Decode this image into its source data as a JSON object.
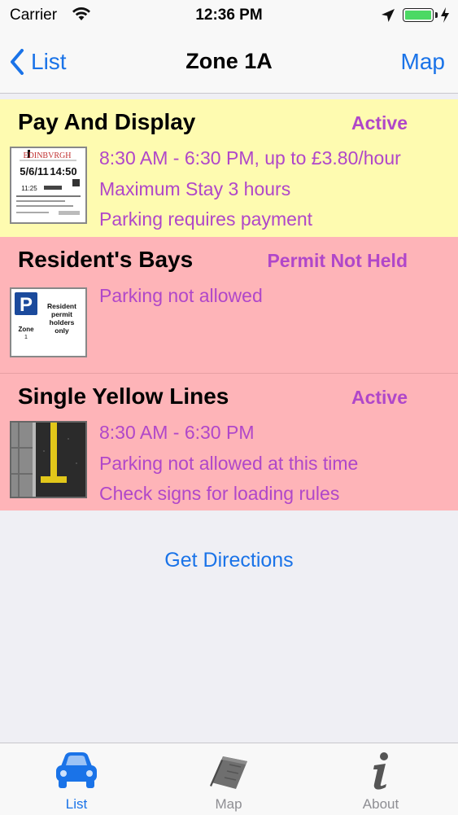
{
  "status_bar": {
    "carrier": "Carrier",
    "time": "12:36 PM"
  },
  "nav": {
    "back_label": "List",
    "title": "Zone 1A",
    "right_label": "Map"
  },
  "restrictions": [
    {
      "title": "Pay And Display",
      "status": "Active",
      "icon": "pay-and-display-ticket",
      "lines": [
        "8:30 AM - 6:30 PM, up to £3.80/hour",
        "Maximum Stay 3 hours",
        "Parking requires payment"
      ],
      "background": "#fefbb0"
    },
    {
      "title": "Resident's Bays",
      "status": "Permit Not Held",
      "icon": "resident-permit-sign",
      "lines": [
        "Parking not allowed"
      ],
      "background": "#feb4b8"
    },
    {
      "title": "Single Yellow Lines",
      "status": "Active",
      "icon": "single-yellow-line-road",
      "lines": [
        "8:30 AM - 6:30 PM",
        "Parking not allowed at this time",
        "Check signs for loading rules"
      ],
      "background": "#feb4b8"
    }
  ],
  "thumb_text": {
    "ticket_brand": "EDINBVRGH",
    "ticket_code": "5/6/11",
    "ticket_time": "14:50",
    "ticket_small": "11:25",
    "resident_sign": "Resident permit holders only",
    "resident_zone": "Zone 1",
    "resident_p": "P"
  },
  "directions_label": "Get Directions",
  "tabs": [
    {
      "label": "List",
      "icon": "car-icon",
      "selected": true
    },
    {
      "label": "Map",
      "icon": "map-icon",
      "selected": false
    },
    {
      "label": "About",
      "icon": "info-icon",
      "selected": false
    }
  ],
  "colors": {
    "accent": "#1a73e8",
    "status_text": "#b047c9",
    "active_bg": "#fefbb0",
    "restricted_bg": "#feb4b8"
  }
}
